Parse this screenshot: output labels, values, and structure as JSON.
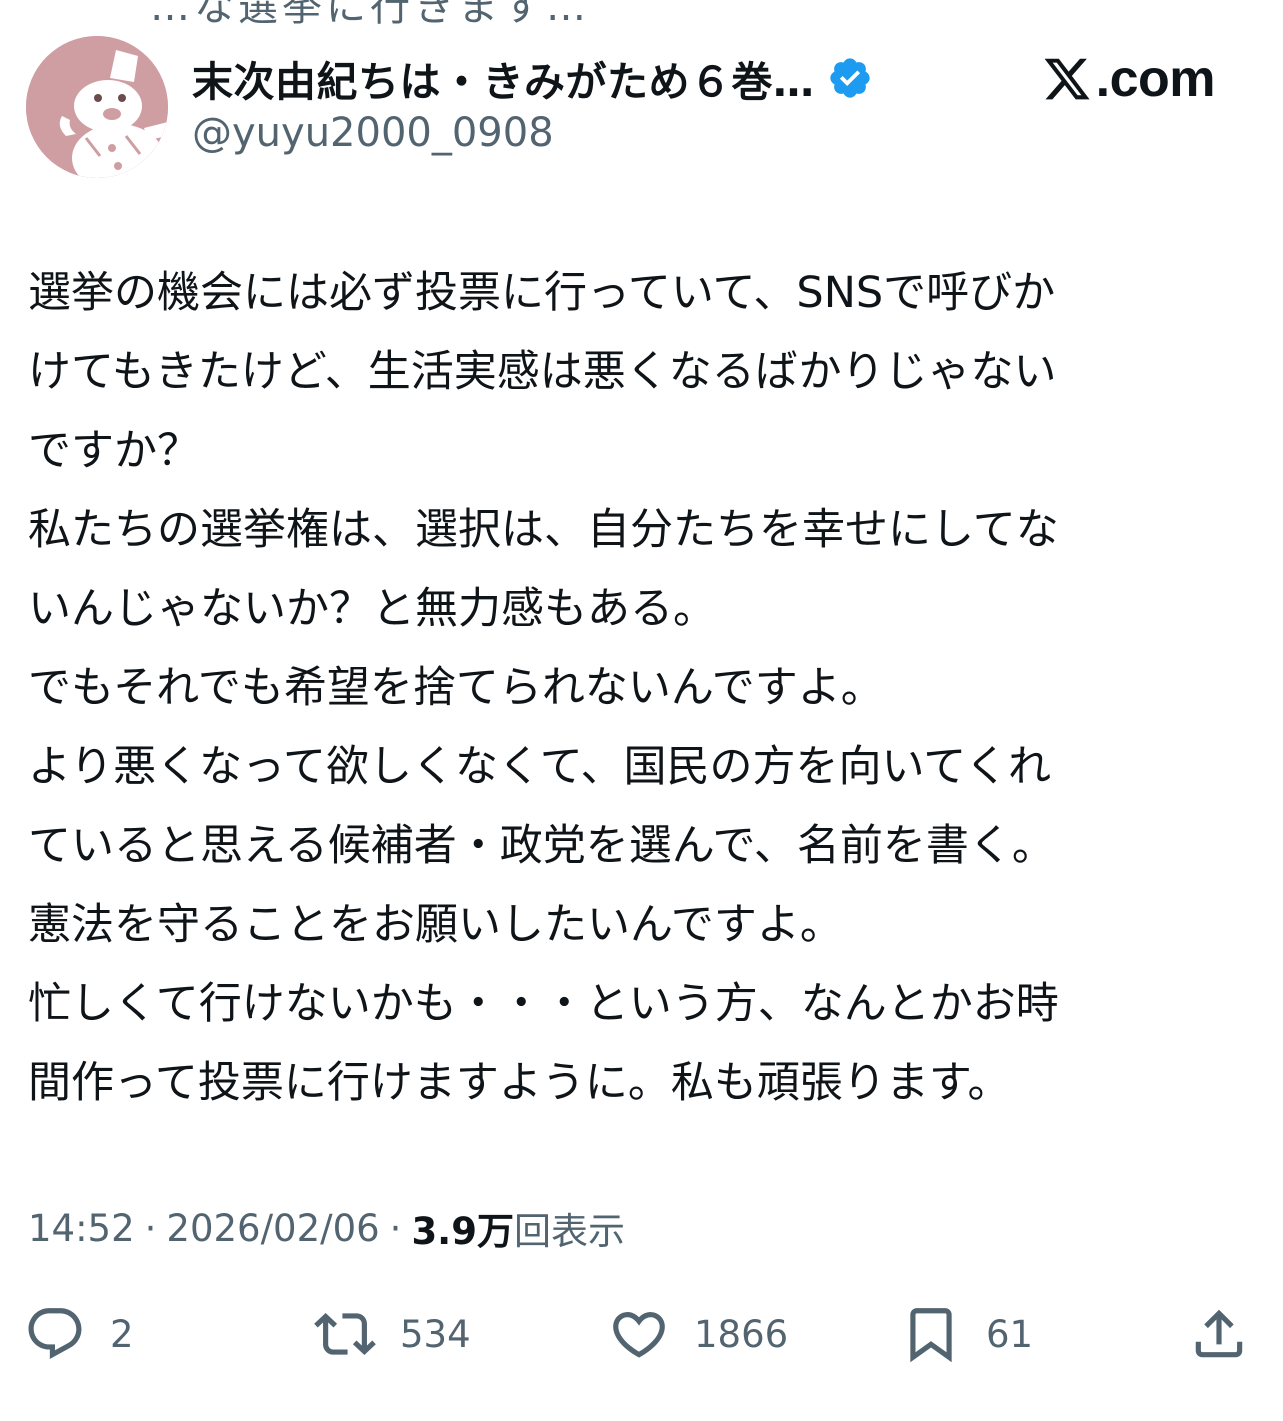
{
  "top_cut_text": "…な選挙に行きます…",
  "author": {
    "display_name": "末次由紀ちは・きみがため６巻…",
    "handle": "@yuyu2000_0908",
    "verified": true,
    "avatar_icon": "snowman-avatar-icon",
    "verified_icon": "verified-badge-icon"
  },
  "site": {
    "logo_icon": "x-logo-icon",
    "text": ".com"
  },
  "tweet": {
    "lines": [
      "選挙の機会には必ず投票に行っていて、SNSで呼びか",
      "けてもきたけど、生活実感は悪くなるばかりじゃない",
      "ですか？",
      "私たちの選挙権は、選択は、自分たちを幸せにしてな",
      "いんじゃないか？と無力感もある。",
      "でもそれでも希望を捨てられないんですよ。",
      "より悪くなって欲しくなくて、国民の方を向いてくれ",
      "ていると思える候補者・政党を選んで、名前を書く。",
      "憲法を守ることをお願いしたいんですよ。",
      "忙しくて行けないかも・・・という方、なんとかお時",
      "間作って投票に行けますように。私も頑張ります。"
    ]
  },
  "meta": {
    "time": "14:52",
    "separator": "·",
    "date": "2026/02/06",
    "views_count": "3.9万",
    "views_label": "回表示"
  },
  "actions": {
    "reply": {
      "icon": "reply-icon",
      "count": "2"
    },
    "retweet": {
      "icon": "retweet-icon",
      "count": "534"
    },
    "like": {
      "icon": "heart-icon",
      "count": "1866"
    },
    "bookmark": {
      "icon": "bookmark-icon",
      "count": "61"
    },
    "share": {
      "icon": "share-icon"
    }
  },
  "colors": {
    "text_primary": "#0f1419",
    "text_secondary": "#536471",
    "verified_blue": "#1d9bf0",
    "avatar_bg": "#cf9ea3"
  }
}
